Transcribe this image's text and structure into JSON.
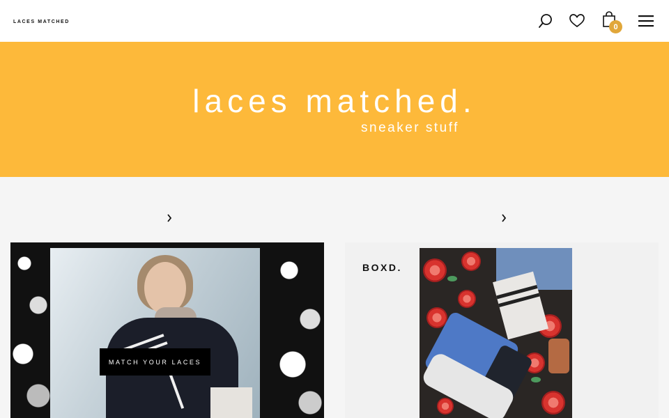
{
  "header": {
    "logo": "LACES MATCHED",
    "cart_count": "0",
    "icons": [
      "search-icon",
      "heart-icon",
      "cart-icon",
      "menu-icon"
    ]
  },
  "hero": {
    "title": "laces matched.",
    "subtitle": "sneaker stuff",
    "background_color": "#fdb93a"
  },
  "cards": [
    {
      "cta": "MATCH YOUR LACES"
    },
    {
      "brand": "BOXD."
    }
  ],
  "colors": {
    "accent": "#fdb93a",
    "badge": "#e1a73a"
  }
}
